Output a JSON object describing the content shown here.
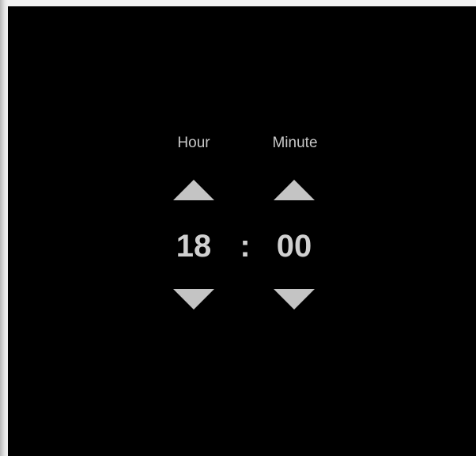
{
  "time_picker": {
    "hour_label": "Hour",
    "minute_label": "Minute",
    "hour_value": "18",
    "minute_value": "00",
    "separator": ":"
  },
  "colors": {
    "background": "#000000",
    "foreground": "#c4c4c4"
  },
  "icons": {
    "increment": "triangle-up-icon",
    "decrement": "triangle-down-icon"
  }
}
